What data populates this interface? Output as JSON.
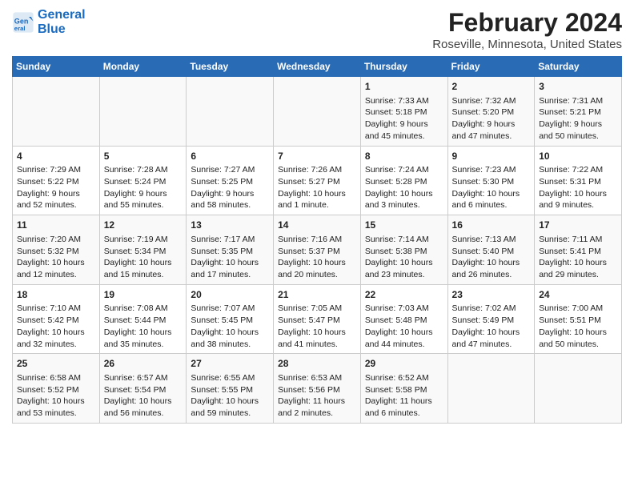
{
  "header": {
    "logo_line1": "General",
    "logo_line2": "Blue",
    "title": "February 2024",
    "subtitle": "Roseville, Minnesota, United States"
  },
  "columns": [
    "Sunday",
    "Monday",
    "Tuesday",
    "Wednesday",
    "Thursday",
    "Friday",
    "Saturday"
  ],
  "weeks": [
    [
      {
        "day": "",
        "text": ""
      },
      {
        "day": "",
        "text": ""
      },
      {
        "day": "",
        "text": ""
      },
      {
        "day": "",
        "text": ""
      },
      {
        "day": "1",
        "text": "Sunrise: 7:33 AM\nSunset: 5:18 PM\nDaylight: 9 hours and 45 minutes."
      },
      {
        "day": "2",
        "text": "Sunrise: 7:32 AM\nSunset: 5:20 PM\nDaylight: 9 hours and 47 minutes."
      },
      {
        "day": "3",
        "text": "Sunrise: 7:31 AM\nSunset: 5:21 PM\nDaylight: 9 hours and 50 minutes."
      }
    ],
    [
      {
        "day": "4",
        "text": "Sunrise: 7:29 AM\nSunset: 5:22 PM\nDaylight: 9 hours and 52 minutes."
      },
      {
        "day": "5",
        "text": "Sunrise: 7:28 AM\nSunset: 5:24 PM\nDaylight: 9 hours and 55 minutes."
      },
      {
        "day": "6",
        "text": "Sunrise: 7:27 AM\nSunset: 5:25 PM\nDaylight: 9 hours and 58 minutes."
      },
      {
        "day": "7",
        "text": "Sunrise: 7:26 AM\nSunset: 5:27 PM\nDaylight: 10 hours and 1 minute."
      },
      {
        "day": "8",
        "text": "Sunrise: 7:24 AM\nSunset: 5:28 PM\nDaylight: 10 hours and 3 minutes."
      },
      {
        "day": "9",
        "text": "Sunrise: 7:23 AM\nSunset: 5:30 PM\nDaylight: 10 hours and 6 minutes."
      },
      {
        "day": "10",
        "text": "Sunrise: 7:22 AM\nSunset: 5:31 PM\nDaylight: 10 hours and 9 minutes."
      }
    ],
    [
      {
        "day": "11",
        "text": "Sunrise: 7:20 AM\nSunset: 5:32 PM\nDaylight: 10 hours and 12 minutes."
      },
      {
        "day": "12",
        "text": "Sunrise: 7:19 AM\nSunset: 5:34 PM\nDaylight: 10 hours and 15 minutes."
      },
      {
        "day": "13",
        "text": "Sunrise: 7:17 AM\nSunset: 5:35 PM\nDaylight: 10 hours and 17 minutes."
      },
      {
        "day": "14",
        "text": "Sunrise: 7:16 AM\nSunset: 5:37 PM\nDaylight: 10 hours and 20 minutes."
      },
      {
        "day": "15",
        "text": "Sunrise: 7:14 AM\nSunset: 5:38 PM\nDaylight: 10 hours and 23 minutes."
      },
      {
        "day": "16",
        "text": "Sunrise: 7:13 AM\nSunset: 5:40 PM\nDaylight: 10 hours and 26 minutes."
      },
      {
        "day": "17",
        "text": "Sunrise: 7:11 AM\nSunset: 5:41 PM\nDaylight: 10 hours and 29 minutes."
      }
    ],
    [
      {
        "day": "18",
        "text": "Sunrise: 7:10 AM\nSunset: 5:42 PM\nDaylight: 10 hours and 32 minutes."
      },
      {
        "day": "19",
        "text": "Sunrise: 7:08 AM\nSunset: 5:44 PM\nDaylight: 10 hours and 35 minutes."
      },
      {
        "day": "20",
        "text": "Sunrise: 7:07 AM\nSunset: 5:45 PM\nDaylight: 10 hours and 38 minutes."
      },
      {
        "day": "21",
        "text": "Sunrise: 7:05 AM\nSunset: 5:47 PM\nDaylight: 10 hours and 41 minutes."
      },
      {
        "day": "22",
        "text": "Sunrise: 7:03 AM\nSunset: 5:48 PM\nDaylight: 10 hours and 44 minutes."
      },
      {
        "day": "23",
        "text": "Sunrise: 7:02 AM\nSunset: 5:49 PM\nDaylight: 10 hours and 47 minutes."
      },
      {
        "day": "24",
        "text": "Sunrise: 7:00 AM\nSunset: 5:51 PM\nDaylight: 10 hours and 50 minutes."
      }
    ],
    [
      {
        "day": "25",
        "text": "Sunrise: 6:58 AM\nSunset: 5:52 PM\nDaylight: 10 hours and 53 minutes."
      },
      {
        "day": "26",
        "text": "Sunrise: 6:57 AM\nSunset: 5:54 PM\nDaylight: 10 hours and 56 minutes."
      },
      {
        "day": "27",
        "text": "Sunrise: 6:55 AM\nSunset: 5:55 PM\nDaylight: 10 hours and 59 minutes."
      },
      {
        "day": "28",
        "text": "Sunrise: 6:53 AM\nSunset: 5:56 PM\nDaylight: 11 hours and 2 minutes."
      },
      {
        "day": "29",
        "text": "Sunrise: 6:52 AM\nSunset: 5:58 PM\nDaylight: 11 hours and 6 minutes."
      },
      {
        "day": "",
        "text": ""
      },
      {
        "day": "",
        "text": ""
      }
    ]
  ]
}
